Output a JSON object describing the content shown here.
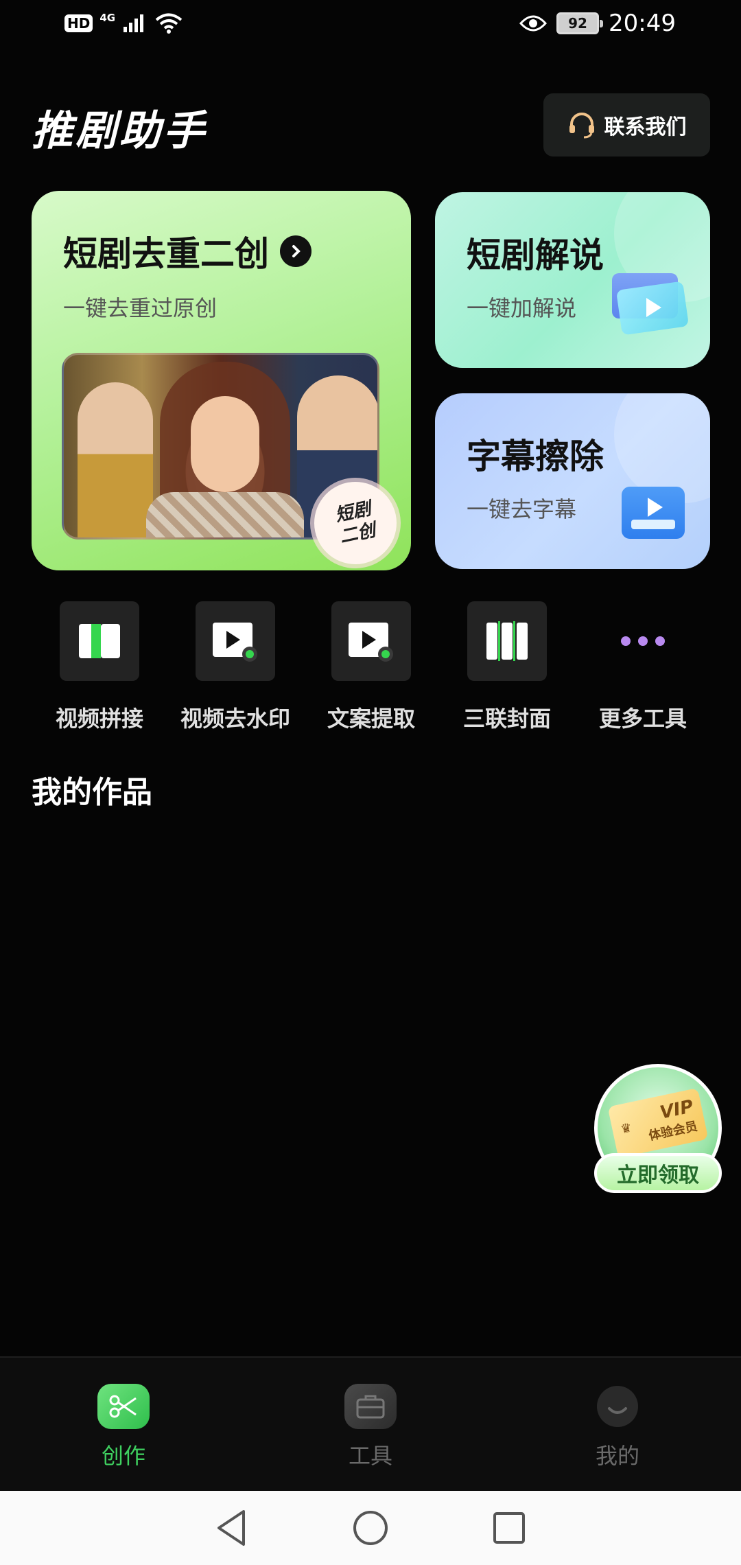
{
  "status_bar": {
    "hd_label": "HD",
    "network_label": "4G",
    "battery_level": "92",
    "time": "20:49"
  },
  "header": {
    "app_title": "推剧助手",
    "contact_label": "联系我们"
  },
  "cards": {
    "main": {
      "title": "短剧去重二创",
      "subtitle": "一键去重过原创",
      "badge_line1": "短剧",
      "badge_line2": "二创"
    },
    "narrate": {
      "title": "短剧解说",
      "subtitle": "一键加解说"
    },
    "subtitle_erase": {
      "title": "字幕擦除",
      "subtitle": "一键去字幕"
    }
  },
  "tools": [
    {
      "label": "视频拼接",
      "icon": "video-splice-icon"
    },
    {
      "label": "视频去水印",
      "icon": "watermark-remove-icon"
    },
    {
      "label": "文案提取",
      "icon": "text-extract-icon"
    },
    {
      "label": "三联封面",
      "icon": "triple-cover-icon"
    },
    {
      "label": "更多工具",
      "icon": "more-dots-icon"
    }
  ],
  "works": {
    "title": "我的作品"
  },
  "vip_promo": {
    "ticket_title": "VIP",
    "ticket_sub": "体验会员",
    "button_label": "立即领取"
  },
  "bottom_nav": {
    "items": [
      {
        "label": "创作",
        "active": true
      },
      {
        "label": "工具",
        "active": false
      },
      {
        "label": "我的",
        "active": false
      }
    ]
  },
  "colors": {
    "accent_green": "#3fd160",
    "background": "#050505"
  }
}
